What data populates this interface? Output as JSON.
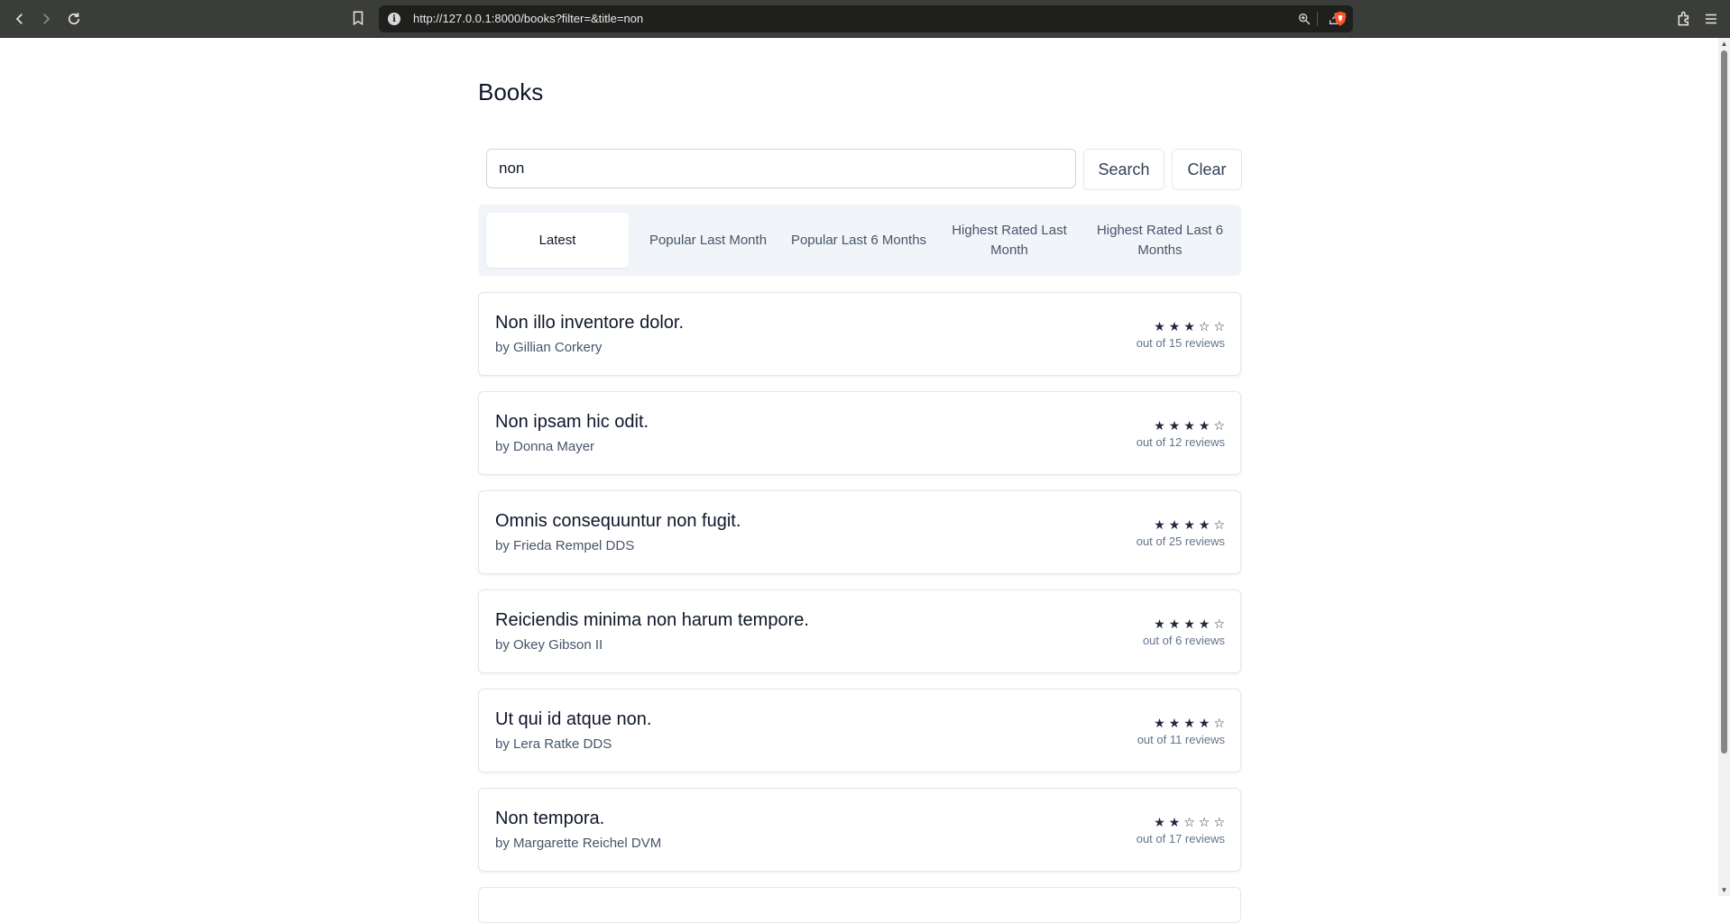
{
  "browser": {
    "url": "http://127.0.0.1:8000/books?filter=&title=non"
  },
  "page": {
    "title": "Books"
  },
  "search": {
    "value": "non",
    "search_label": "Search",
    "clear_label": "Clear"
  },
  "tabs": [
    {
      "label": "Latest",
      "active": true
    },
    {
      "label": "Popular Last Month",
      "active": false
    },
    {
      "label": "Popular Last 6 Months",
      "active": false
    },
    {
      "label": "Highest Rated Last Month",
      "active": false
    },
    {
      "label": "Highest Rated Last 6 Months",
      "active": false
    }
  ],
  "books": [
    {
      "title": "Non illo inventore dolor.",
      "author": "by Gillian Corkery",
      "rating": 3,
      "stars": "★★★☆☆",
      "reviews": "out of 15 reviews"
    },
    {
      "title": "Non ipsam hic odit.",
      "author": "by Donna Mayer",
      "rating": 4,
      "stars": "★★★★☆",
      "reviews": "out of 12 reviews"
    },
    {
      "title": "Omnis consequuntur non fugit.",
      "author": "by Frieda Rempel DDS",
      "rating": 4,
      "stars": "★★★★☆",
      "reviews": "out of 25 reviews"
    },
    {
      "title": "Reiciendis minima non harum tempore.",
      "author": "by Okey Gibson II",
      "rating": 4,
      "stars": "★★★★☆",
      "reviews": "out of 6 reviews"
    },
    {
      "title": "Ut qui id atque non.",
      "author": "by Lera Ratke DDS",
      "rating": 4,
      "stars": "★★★★☆",
      "reviews": "out of 11 reviews"
    },
    {
      "title": "Non tempora.",
      "author": "by Margarette Reichel DVM",
      "rating": 2,
      "stars": "★★☆☆☆",
      "reviews": "out of 17 reviews"
    }
  ]
}
